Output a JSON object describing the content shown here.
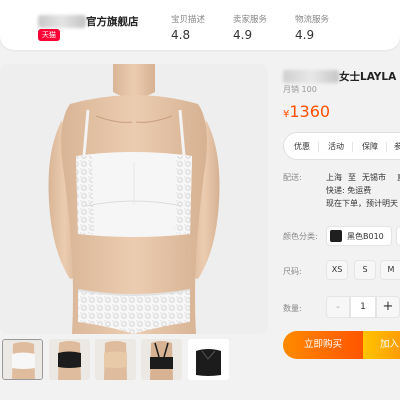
{
  "store": {
    "name": "官方旗舰店",
    "badge": "天猫",
    "scores": [
      {
        "label": "宝贝描述",
        "value": "4.8"
      },
      {
        "label": "卖家服务",
        "value": "4.9"
      },
      {
        "label": "物流服务",
        "value": "4.9"
      }
    ]
  },
  "product": {
    "title": "女士LAYLA",
    "sales": "月销 100",
    "currency": "¥",
    "price": "1360"
  },
  "promo": {
    "items": [
      "优惠",
      "活动",
      "保障",
      "参"
    ]
  },
  "shipping": {
    "label": "配送:",
    "from": "上海",
    "to_word": "至",
    "to": "无锡市",
    "extra": "直",
    "fee": "快递: 免运费",
    "eta": "现在下单，预计明天"
  },
  "options": {
    "color_label": "颜色分类:",
    "color_selected": "黑色B010",
    "size_label": "尺码:",
    "sizes": [
      "XS",
      "S",
      "M"
    ],
    "qty_label": "数量:",
    "qty_minus": "-",
    "qty_value": "1",
    "qty_plus": "+"
  },
  "actions": {
    "buy_now": "立即购买",
    "add_cart": "加入"
  },
  "thumbnails": [
    {
      "name": "white-cami",
      "color": "#f4f4f4"
    },
    {
      "name": "black-cami",
      "color": "#1c1c1c"
    },
    {
      "name": "nude-cami",
      "color": "#e8c9a8"
    },
    {
      "name": "black-cami-back",
      "color": "#1c1c1c"
    },
    {
      "name": "black-lace-top",
      "color": "#1c1c1c"
    }
  ],
  "colors": {
    "accent": "#ff5000",
    "tmall": "#ff0036",
    "buy_start": "#ff8a00",
    "buy_end": "#ff5500",
    "cart_start": "#ffc400",
    "cart_end": "#ff9a00"
  }
}
